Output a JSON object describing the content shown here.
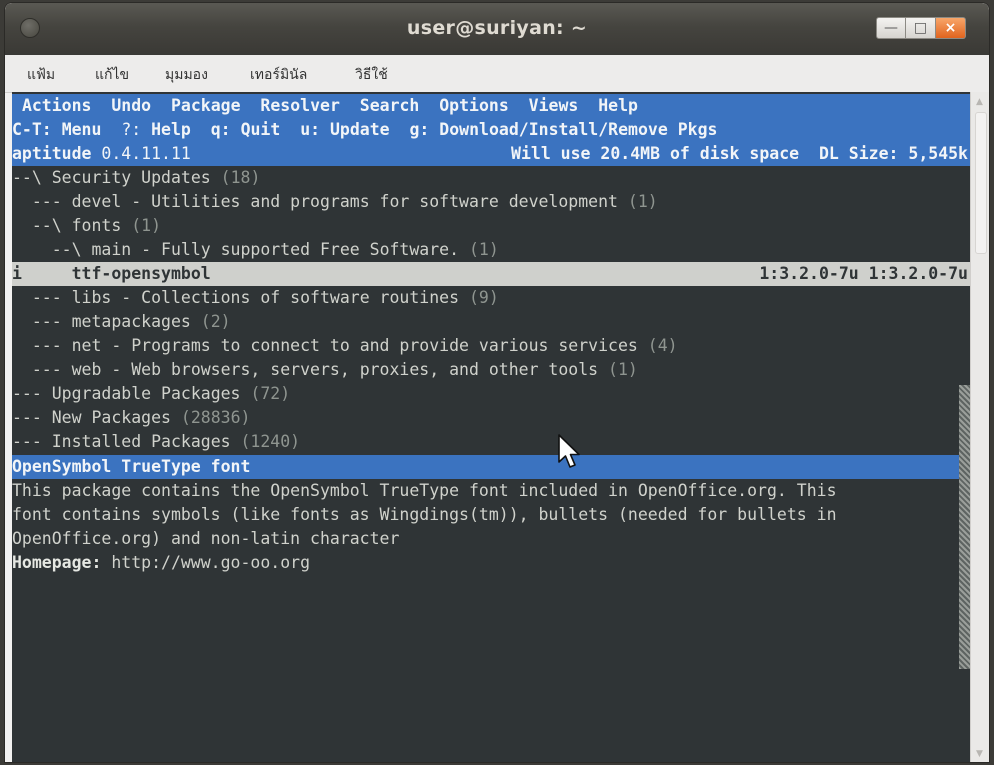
{
  "window": {
    "title": "user@suriyan: ~",
    "min_glyph": "—",
    "max_glyph": "□",
    "close_glyph": "×"
  },
  "menubar": [
    "แฟ้ม",
    "แก้ไข",
    "มุมมอง",
    "เทอร์มินัล",
    "วิธีใช้"
  ],
  "aptitude": {
    "menu": [
      "Actions",
      "Undo",
      "Package",
      "Resolver",
      "Search",
      "Options",
      "Views",
      "Help"
    ],
    "shortcuts": [
      {
        "key": "C-T:",
        "label": "Menu"
      },
      {
        "key": "?:",
        "label": "Help"
      },
      {
        "key": "q:",
        "label": "Quit"
      },
      {
        "key": "u:",
        "label": "Update"
      },
      {
        "key": "g:",
        "label": "Download/Install/Remove Pkgs"
      }
    ],
    "status": {
      "name": "aptitude",
      "version": "0.4.11.11",
      "disk": "Will use 20.4MB of disk space",
      "dl": "DL Size: 5,545k"
    },
    "tree": [
      {
        "prefix": "--\\ ",
        "name": "Security Updates",
        "count": "(18)"
      },
      {
        "prefix": "  --- ",
        "name": "devel - Utilities and programs for software development",
        "count": "(1)"
      },
      {
        "prefix": "  --\\ ",
        "name": "fonts",
        "count": "(1)"
      },
      {
        "prefix": "    --\\ ",
        "name": "main - Fully supported Free Software.",
        "count": "(1)"
      },
      {
        "prefix": "i     ",
        "name": "ttf-opensymbol",
        "versions": "1:3.2.0-7u 1:3.2.0-7u",
        "selected": true
      },
      {
        "prefix": "  --- ",
        "name": "libs - Collections of software routines",
        "count": "(9)"
      },
      {
        "prefix": "  --- ",
        "name": "metapackages",
        "count": "(2)"
      },
      {
        "prefix": "  --- ",
        "name": "net - Programs to connect to and provide various services",
        "count": "(4)"
      },
      {
        "prefix": "  --- ",
        "name": "web - Web browsers, servers, proxies, and other tools",
        "count": "(1)"
      },
      {
        "prefix": "--- ",
        "name": "Upgradable Packages",
        "count": "(72)"
      },
      {
        "prefix": "--- ",
        "name": "New Packages",
        "count": "(28836)"
      },
      {
        "prefix": "--- ",
        "name": "Installed Packages",
        "count": "(1240)"
      }
    ],
    "desc_title": "OpenSymbol TrueType font",
    "desc_lines": [
      "This package contains the OpenSymbol TrueType font included in OpenOffice.org. This",
      "font contains symbols (like fonts as Wingdings(tm)), bullets (needed for bullets in",
      "OpenOffice.org) and non-latin character"
    ],
    "homepage_label": "Homepage:",
    "homepage_url": " http://www.go-oo.org"
  }
}
